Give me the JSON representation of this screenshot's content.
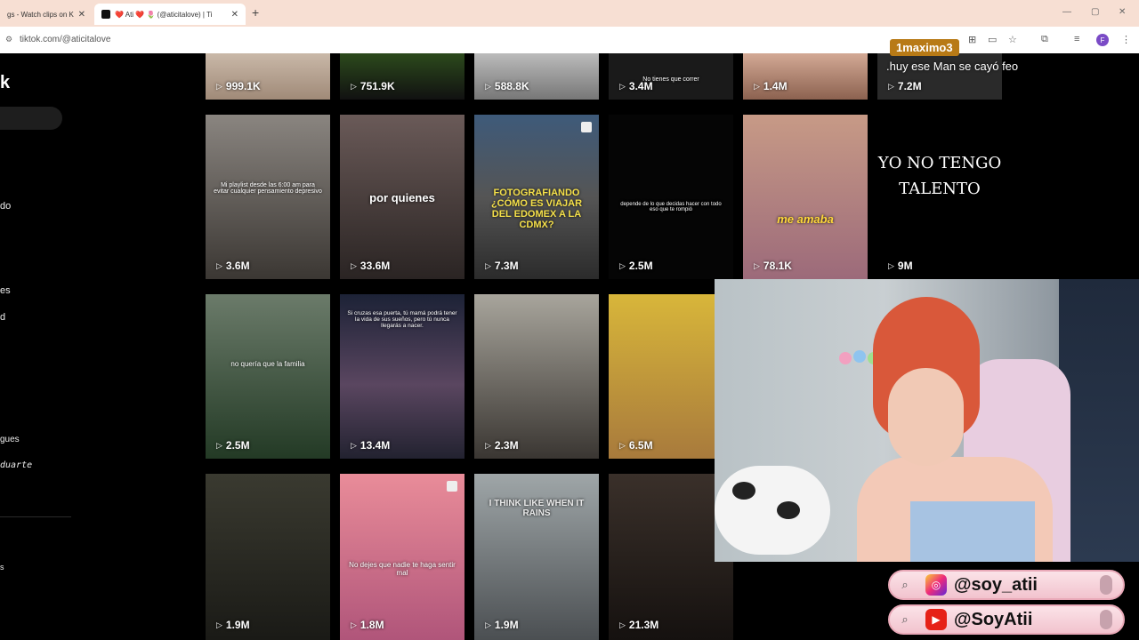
{
  "browser": {
    "tabs": [
      {
        "title": "gs - Watch clips on K"
      },
      {
        "title": "❤️ Ati ❤️ 🌷 (@aticitalove) | Ti"
      }
    ],
    "url": "tiktok.com/@aticitalove",
    "profile_initial": "F"
  },
  "sidebar": {
    "logo": "k",
    "items": [
      "",
      "do",
      "es",
      "d",
      "gues",
      "duarte",
      "s"
    ]
  },
  "grid": {
    "row0": [
      {
        "views": "999.1K"
      },
      {
        "views": "751.9K"
      },
      {
        "views": "588.8K"
      },
      {
        "views": "3.4M",
        "caption": "No tienes que correr"
      },
      {
        "views": "1.4M"
      },
      {
        "views": "7.2M"
      }
    ],
    "row1": [
      {
        "views": "3.6M",
        "caption": "Mi playlist desde las 6:00 am para evitar cualquier pensamiento depresivo"
      },
      {
        "views": "33.6M",
        "caption": "por quienes"
      },
      {
        "views": "7.3M",
        "caption": "FOTOGRAFIANDO ¿CÓMO ES VIAJAR DEL EDOMEX A LA CDMX?"
      },
      {
        "views": "2.5M",
        "caption": "depende de lo que decidas hacer con todo eso que te rompió"
      },
      {
        "views": "78.1K",
        "caption": "me amaba"
      },
      {
        "views": "9M",
        "caption": "YO NO TENGO TALENTO"
      }
    ],
    "row2": [
      {
        "views": "2.5M",
        "caption": "no quería que la familia"
      },
      {
        "views": "13.4M",
        "caption": "Si cruzas esa puerta, tú mamá podrá tener la vida de sus sueños, pero tú nunca llegarás a nacer."
      },
      {
        "views": "2.3M"
      },
      {
        "views": "6.5M"
      }
    ],
    "row3": [
      {
        "views": "1.9M"
      },
      {
        "views": "1.8M",
        "caption": "No dejes que nadie te haga sentir mal"
      },
      {
        "views": "1.9M",
        "caption": "I THINK LIKE WHEN IT RAINS"
      },
      {
        "views": "21.3M"
      }
    ]
  },
  "chat": {
    "username": "1maximo3",
    "message": ".huy ese Man se cayó feo"
  },
  "socials": [
    {
      "platform": "instagram-icon",
      "handle": "@soy_atii",
      "color": "#d6298c"
    },
    {
      "platform": "youtube-icon",
      "handle": "@SoyAtii",
      "color": "#e62117"
    }
  ]
}
